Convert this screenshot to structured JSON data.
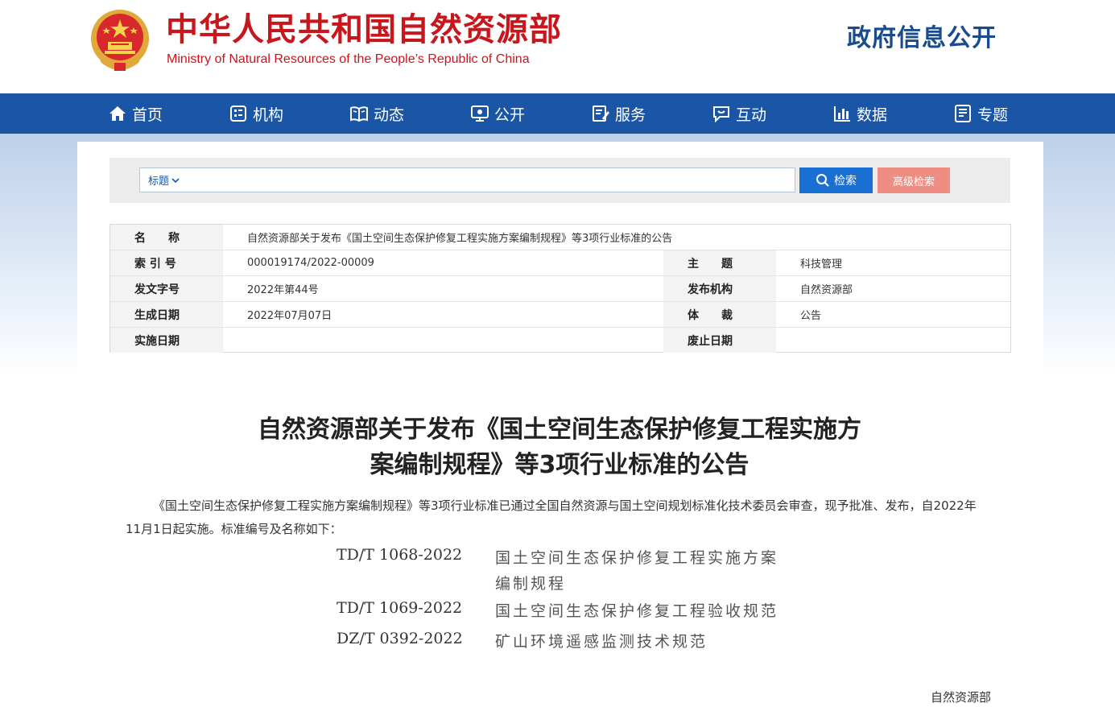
{
  "header": {
    "title": "中华人民共和国自然资源部",
    "subtitle": "Ministry of Natural Resources of the People’s Republic of China",
    "right_title": "政府信息公开"
  },
  "nav": [
    {
      "label": "首页",
      "icon": "home-icon"
    },
    {
      "label": "机构",
      "icon": "org-icon"
    },
    {
      "label": "动态",
      "icon": "book-icon"
    },
    {
      "label": "公开",
      "icon": "monitor-icon"
    },
    {
      "label": "服务",
      "icon": "edit-icon"
    },
    {
      "label": "互动",
      "icon": "chat-icon"
    },
    {
      "label": "数据",
      "icon": "bar-chart-icon"
    },
    {
      "label": "专题",
      "icon": "document-icon"
    }
  ],
  "search": {
    "field_select": "标题",
    "placeholder": "",
    "search_label": "检索",
    "advanced_label": "高级检索"
  },
  "meta": {
    "name_label": "名　　称",
    "name_value": "自然资源部关于发布《国土空间生态保护修复工程实施方案编制规程》等3项行业标准的公告",
    "index_label": "索 引 号",
    "index_value": "000019174/2022-00009",
    "subject_label": "主　　题",
    "subject_value": "科技管理",
    "doc_no_label": "发文字号",
    "doc_no_value": "2022年第44号",
    "issuer_label": "发布机构",
    "issuer_value": "自然资源部",
    "created_label": "生成日期",
    "created_value": "2022年07月07日",
    "genre_label": "体　　裁",
    "genre_value": "公告",
    "effective_label": "实施日期",
    "effective_value": "",
    "abolish_label": "废止日期",
    "abolish_value": ""
  },
  "article": {
    "title_line1": "自然资源部关于发布《国土空间生态保护修复工程实施方",
    "title_line2": "案编制规程》等3项行业标准的公告",
    "paragraph": "《国土空间生态保护修复工程实施方案编制规程》等3项行业标准已通过全国自然资源与国土空间规划标准化技术委员会审查，现予批准、发布，自2022年11月1日起实施。标准编号及名称如下：",
    "standards": [
      {
        "code": "TD/T 1068-2022",
        "name_line1": "国土空间生态保护修复工程实施方案",
        "name_line2": "编制规程"
      },
      {
        "code": "TD/T 1069-2022",
        "name_line1": "国土空间生态保护修复工程验收规范",
        "name_line2": ""
      },
      {
        "code": "DZ/T 0392-2022",
        "name_line1": "矿山环境遥感监测技术规范",
        "name_line2": ""
      }
    ],
    "signature": "自然资源部"
  }
}
